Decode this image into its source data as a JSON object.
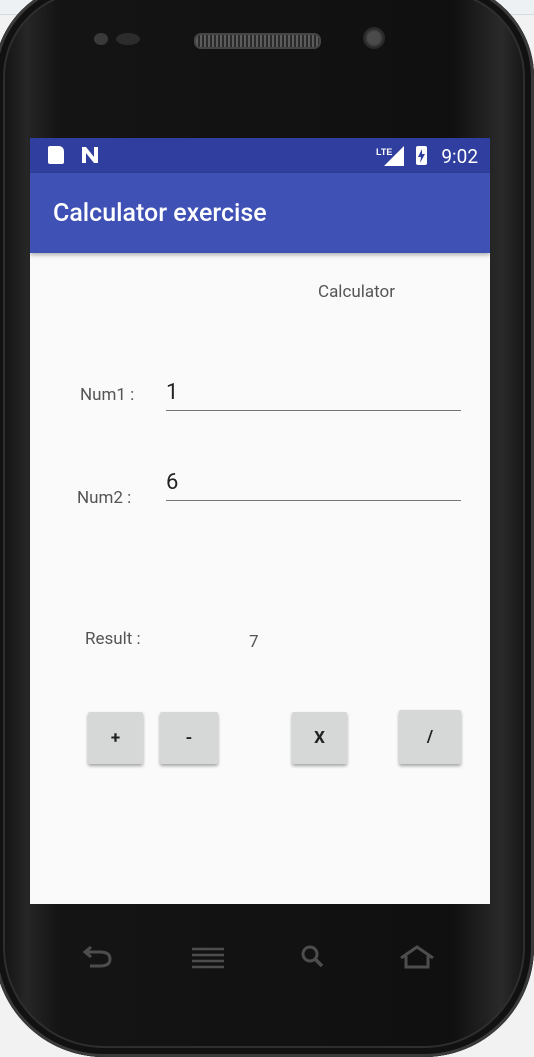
{
  "status_bar": {
    "time": "9:02",
    "network": "LTE"
  },
  "app_bar": {
    "title": "Calculator exercise"
  },
  "content": {
    "heading": "Calculator",
    "num1": {
      "label": "Num1 :",
      "value": "1"
    },
    "num2": {
      "label": "Num2 :",
      "value": "6"
    },
    "result": {
      "label": "Result :",
      "value": "7"
    }
  },
  "buttons": {
    "add": "+",
    "subtract": "-",
    "multiply": "X",
    "divide": "/"
  },
  "colors": {
    "status_bar": "#303f9f",
    "app_bar": "#3f51b5",
    "screen_bg": "#fafafa",
    "button_bg": "#d6d7d7"
  },
  "icons": {
    "status": [
      "sd-card-icon",
      "n-logo-icon",
      "lte-signal-icon",
      "battery-charging-icon"
    ],
    "nav": [
      "back-icon",
      "menu-icon",
      "search-icon",
      "home-icon"
    ]
  }
}
